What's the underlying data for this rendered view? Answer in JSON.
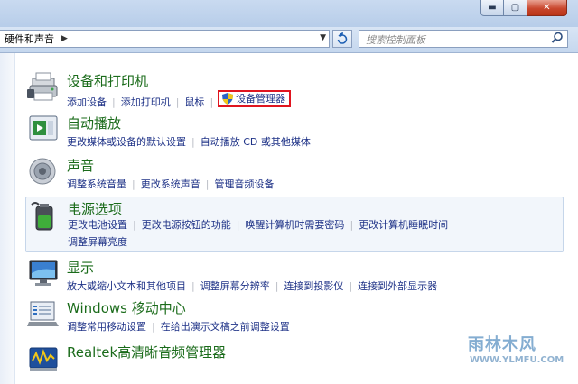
{
  "window": {
    "min_label": "▬",
    "max_label": "▢",
    "close_label": "✕"
  },
  "nav": {
    "breadcrumb": "硬件和声音",
    "search_placeholder": "搜索控制面板"
  },
  "categories": [
    {
      "title": "设备和打印机",
      "icon": "printer-icon",
      "links": [
        "添加设备",
        "添加打印机",
        "鼠标",
        "设备管理器"
      ]
    },
    {
      "title": "自动播放",
      "icon": "autoplay-icon",
      "links": [
        "更改媒体或设备的默认设置",
        "自动播放 CD 或其他媒体"
      ]
    },
    {
      "title": "声音",
      "icon": "speaker-icon",
      "links": [
        "调整系统音量",
        "更改系统声音",
        "管理音频设备"
      ]
    },
    {
      "title": "电源选项",
      "icon": "power-battery-icon",
      "links": [
        "更改电池设置",
        "更改电源按钮的功能",
        "唤醒计算机时需要密码",
        "更改计算机睡眠时间",
        "调整屏幕亮度"
      ]
    },
    {
      "title": "显示",
      "icon": "display-icon",
      "links": [
        "放大或缩小文本和其他项目",
        "调整屏幕分辨率",
        "连接到投影仪",
        "连接到外部显示器"
      ]
    },
    {
      "title": "Windows 移动中心",
      "icon": "mobility-center-icon",
      "links": [
        "调整常用移动设置",
        "在给出演示文稿之前调整设置"
      ]
    },
    {
      "title": "Realtek高清晰音频管理器",
      "icon": "realtek-audio-icon",
      "links": []
    }
  ],
  "watermark": {
    "text": "雨林木风",
    "url": "WWW.YLMFU.COM"
  },
  "colors": {
    "title_green": "#1a6b1a",
    "link_blue": "#1e3287",
    "highlight_border": "#e0151f"
  }
}
